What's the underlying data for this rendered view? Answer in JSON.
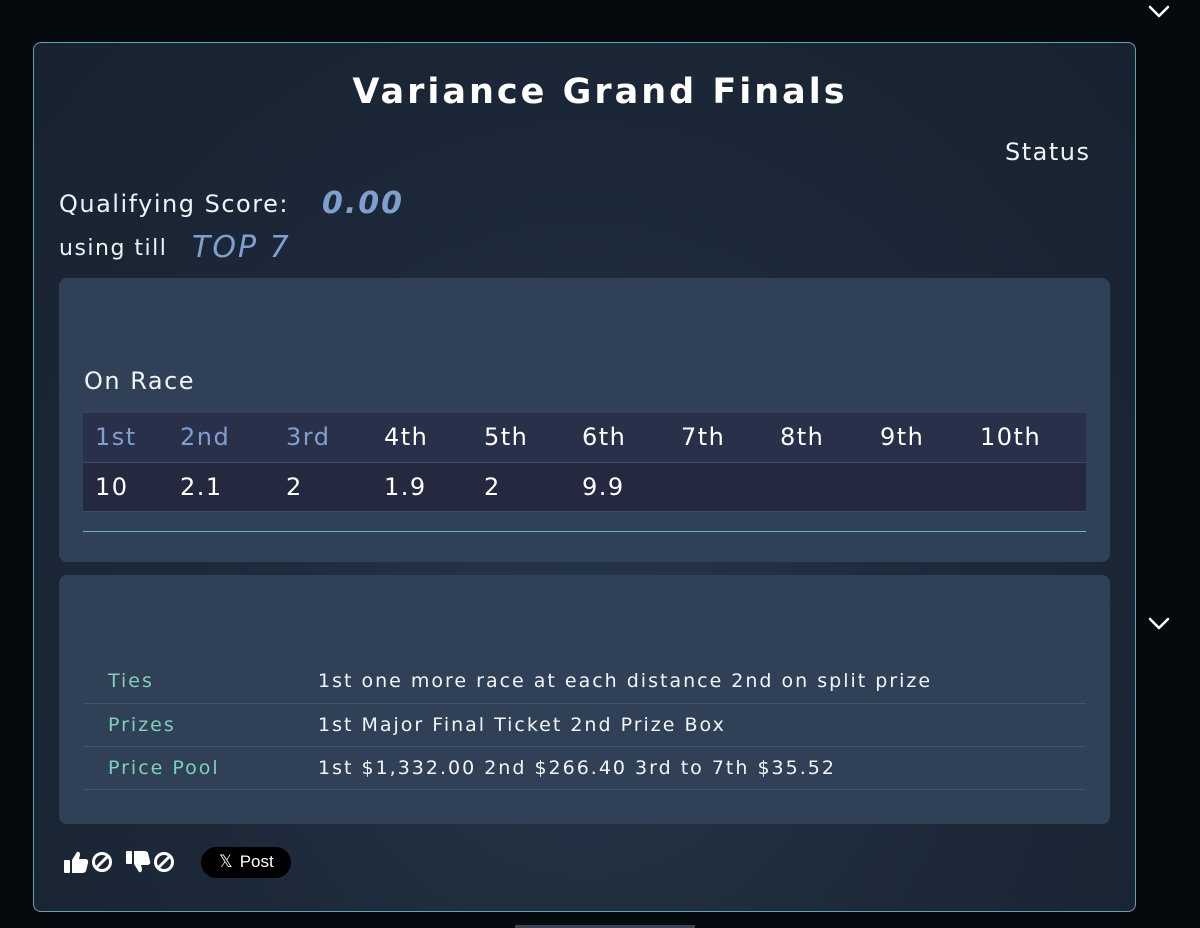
{
  "card": {
    "title": "Variance Grand Finals",
    "status_label": "Status",
    "qualifying_label": "Qualifying Score:",
    "qualifying_value": "0.00",
    "till_label": "using till",
    "till_value": "TOP 7"
  },
  "race_panel": {
    "heading": "On Race",
    "headers": [
      "1st",
      "2nd",
      "3rd",
      "4th",
      "5th",
      "6th",
      "7th",
      "8th",
      "9th",
      "10th"
    ],
    "values": [
      "10",
      "2.1",
      "2",
      "1.9",
      "2",
      "9.9",
      "",
      "",
      "",
      ""
    ],
    "highlight_color": "#7f9fcf"
  },
  "info_panel": {
    "rows": [
      {
        "key": "Ties",
        "value": "1st one more race at each distance 2nd on split prize"
      },
      {
        "key": "Prizes",
        "value": "1st Major Final Ticket 2nd Prize Box"
      },
      {
        "key": "Price Pool",
        "value": "1st $1,332.00 2nd $266.40 3rd to 7th $35.52"
      }
    ]
  },
  "footer": {
    "post_label": "Post",
    "like_icon": "thumbs-up-icon",
    "dislike_icon": "thumbs-down-icon"
  },
  "colors": {
    "accent_blue": "#7f9fcf",
    "accent_teal": "#7fd1b9",
    "border": "#5fa3b8"
  }
}
